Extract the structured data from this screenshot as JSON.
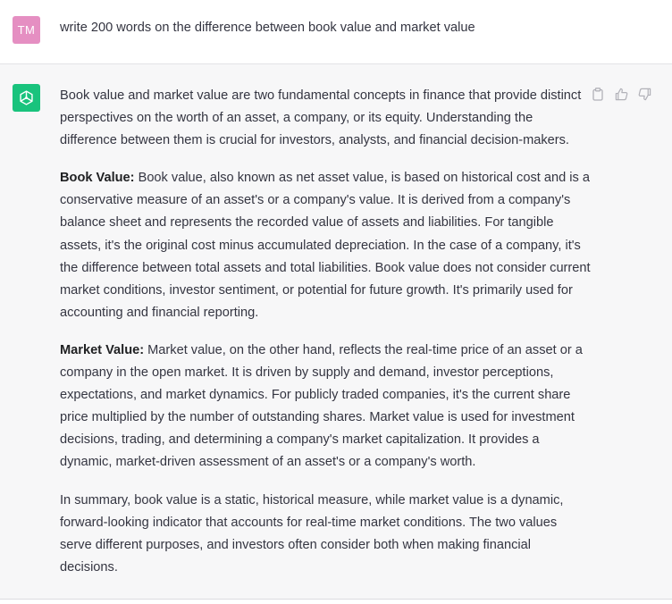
{
  "user": {
    "initials": "TM",
    "prompt": "write 200 words on the difference between book value and market value"
  },
  "assistant": {
    "paragraph_1": "Book value and market value are two fundamental concepts in finance that provide distinct perspectives on the worth of an asset, a company, or its equity. Understanding the difference between them is crucial for investors, analysts, and financial decision-makers.",
    "book_label": "Book Value:",
    "book_text": " Book value, also known as net asset value, is based on historical cost and is a conservative measure of an asset's or a company's value. It is derived from a company's balance sheet and represents the recorded value of assets and liabilities. For tangible assets, it's the original cost minus accumulated depreciation. In the case of a company, it's the difference between total assets and total liabilities. Book value does not consider current market conditions, investor sentiment, or potential for future growth. It's primarily used for accounting and financial reporting.",
    "market_label": "Market Value:",
    "market_text": " Market value, on the other hand, reflects the real-time price of an asset or a company in the open market. It is driven by supply and demand, investor perceptions, expectations, and market dynamics. For publicly traded companies, it's the current share price multiplied by the number of outstanding shares. Market value is used for investment decisions, trading, and determining a company's market capitalization. It provides a dynamic, market-driven assessment of an asset's or a company's worth.",
    "summary": "In summary, book value is a static, historical measure, while market value is a dynamic, forward-looking indicator that accounts for real-time market conditions. The two values serve different purposes, and investors often consider both when making financial decisions."
  },
  "icons": {
    "copy": "clipboard-icon",
    "like": "thumbs-up-icon",
    "dislike": "thumbs-down-icon",
    "assistant_avatar": "openai-logo-icon"
  },
  "colors": {
    "user_avatar": "#e58fc2",
    "assistant_avatar": "#19c37d",
    "assistant_background": "#f7f7f8",
    "text": "#343541"
  }
}
